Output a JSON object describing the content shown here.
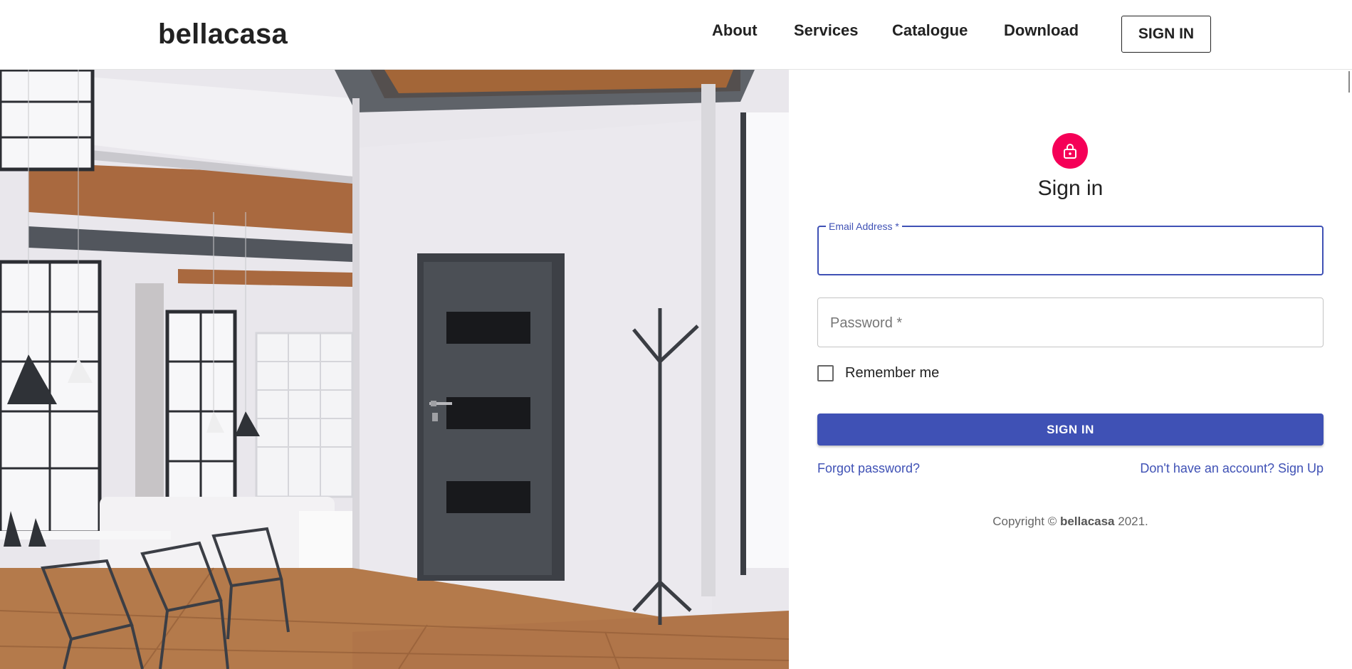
{
  "header": {
    "brand": "bellacasa",
    "nav": [
      "About",
      "Services",
      "Catalogue",
      "Download"
    ],
    "signin_button": "SIGN IN"
  },
  "hero": {
    "alt": "loft interior with door",
    "colors": {
      "wall": "#e8e6ea",
      "wood": "#a5653c",
      "floor": "#b77a4c",
      "door": "#4b4f55",
      "metal": "#3a3d43"
    }
  },
  "form": {
    "title": "Sign in",
    "icon": "lock-icon",
    "email_label": "Email Address *",
    "email_value": "",
    "password_placeholder": "Password *",
    "remember_label": "Remember me",
    "remember_checked": false,
    "submit_label": "SIGN IN",
    "forgot_link": "Forgot password?",
    "signup_link": "Don't have an account? Sign Up",
    "accent_color": "#3f51b5",
    "avatar_color": "#f50057"
  },
  "footer": {
    "copyright_prefix": "Copyright © ",
    "copyright_brand": "bellacasa",
    "copyright_suffix": " 2021."
  }
}
